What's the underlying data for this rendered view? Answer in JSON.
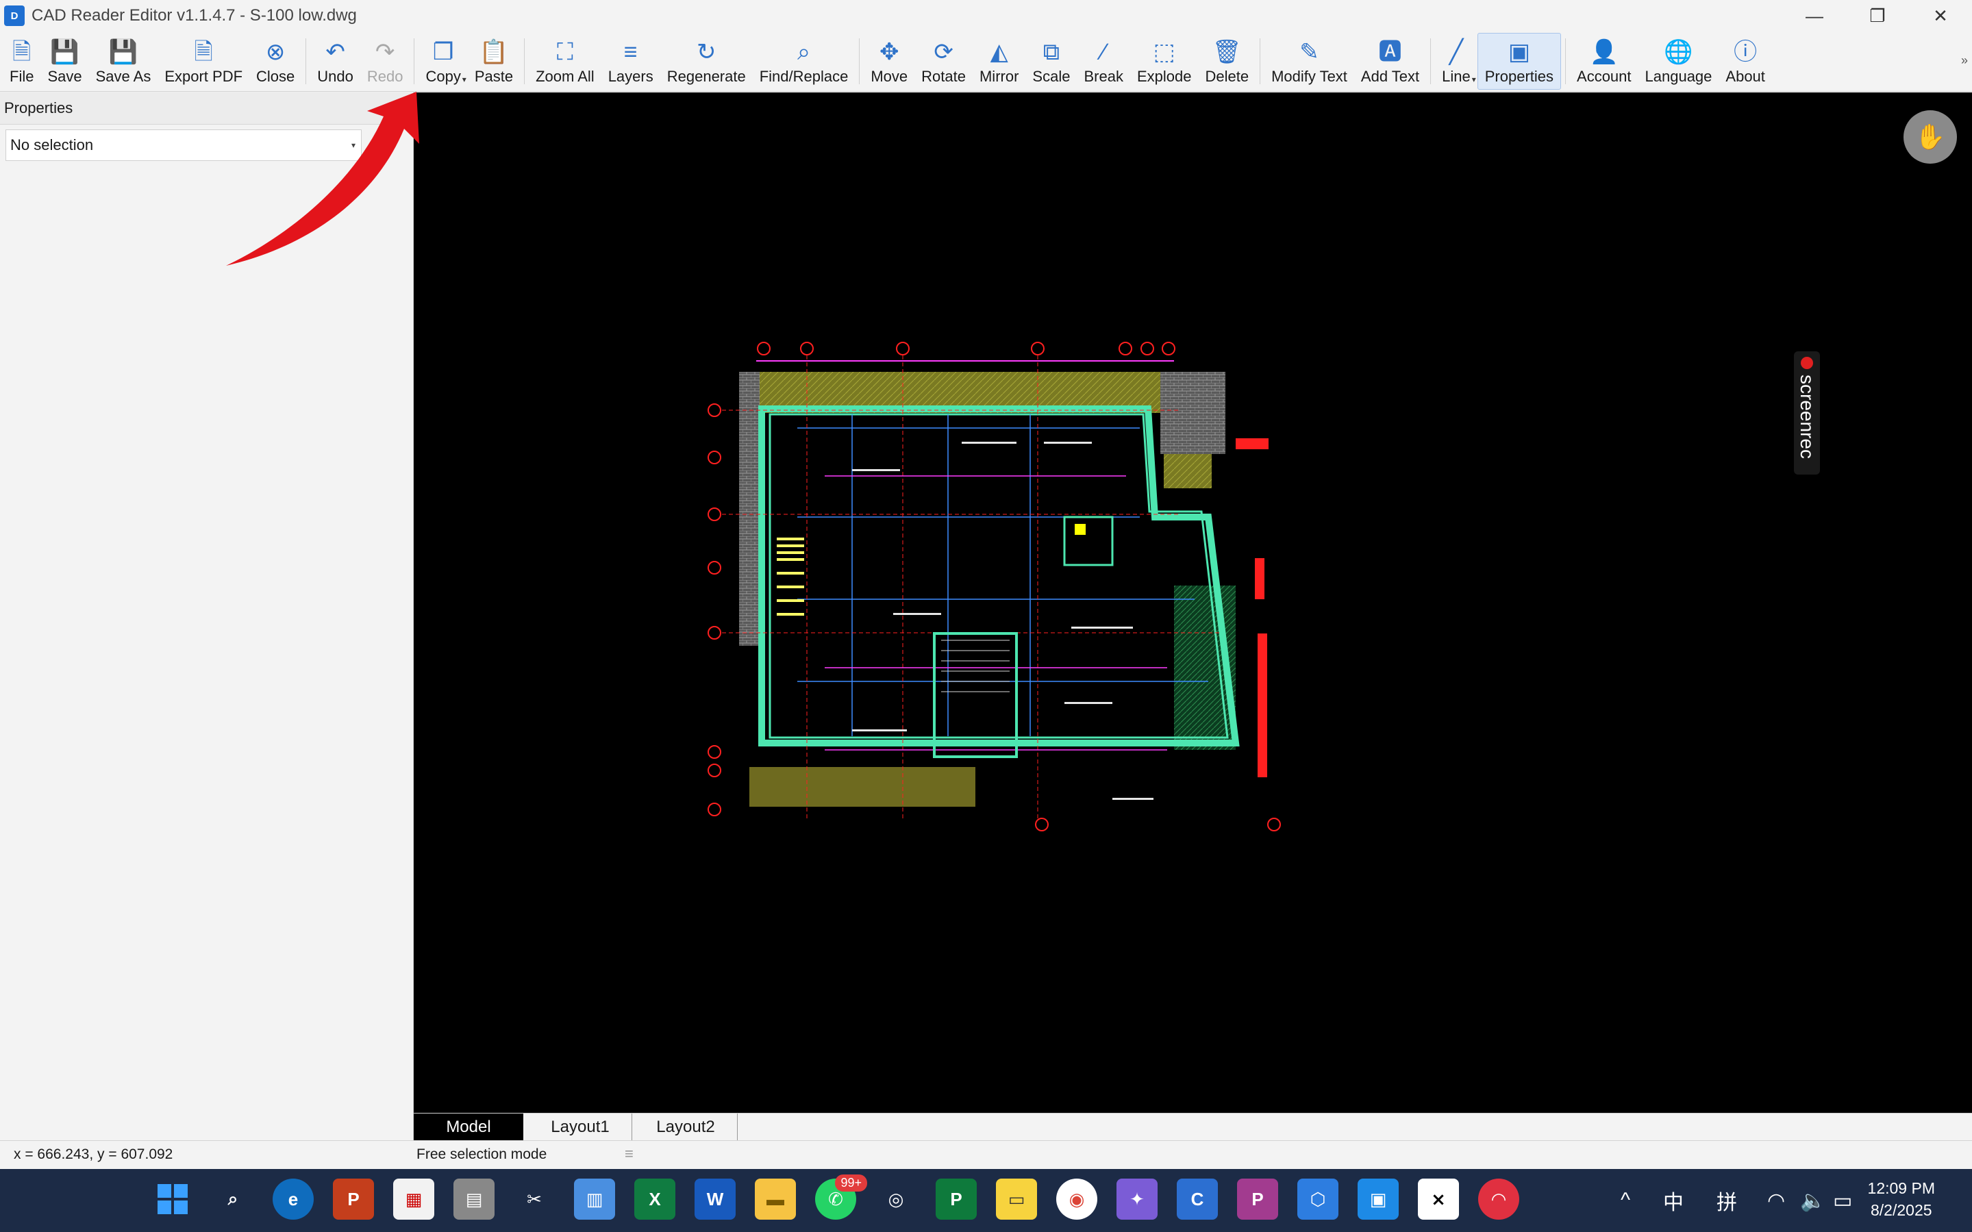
{
  "window": {
    "title": "CAD Reader Editor v1.1.4.7 - S-100 low.dwg",
    "app_icon": "dwg-file-icon",
    "minimize": "—",
    "restore": "❐",
    "close": "✕"
  },
  "toolbar": {
    "items": [
      {
        "id": "file",
        "label": "File",
        "icon": "🗎"
      },
      {
        "id": "save",
        "label": "Save",
        "icon": "💾"
      },
      {
        "id": "save-as",
        "label": "Save As",
        "icon": "💾"
      },
      {
        "id": "export-pdf",
        "label": "Export PDF",
        "icon": "🗎"
      },
      {
        "id": "close",
        "label": "Close",
        "icon": "⊗"
      },
      {
        "id": "undo",
        "label": "Undo",
        "icon": "↶"
      },
      {
        "id": "redo",
        "label": "Redo",
        "icon": "↷"
      },
      {
        "id": "copy",
        "label": "Copy",
        "icon": "❐"
      },
      {
        "id": "paste",
        "label": "Paste",
        "icon": "📋"
      },
      {
        "id": "zoom-all",
        "label": "Zoom All",
        "icon": "⛶"
      },
      {
        "id": "layers",
        "label": "Layers",
        "icon": "≡"
      },
      {
        "id": "regenerate",
        "label": "Regenerate",
        "icon": "↻"
      },
      {
        "id": "find-replace",
        "label": "Find/Replace",
        "icon": "⌕"
      },
      {
        "id": "move",
        "label": "Move",
        "icon": "✥"
      },
      {
        "id": "rotate",
        "label": "Rotate",
        "icon": "⟳"
      },
      {
        "id": "mirror",
        "label": "Mirror",
        "icon": "◭"
      },
      {
        "id": "scale",
        "label": "Scale",
        "icon": "⧉"
      },
      {
        "id": "break",
        "label": "Break",
        "icon": "∕"
      },
      {
        "id": "explode",
        "label": "Explode",
        "icon": "⬚"
      },
      {
        "id": "delete",
        "label": "Delete",
        "icon": "🗑"
      },
      {
        "id": "modify-text",
        "label": "Modify Text",
        "icon": "✎"
      },
      {
        "id": "add-text",
        "label": "Add Text",
        "icon": "🅰"
      },
      {
        "id": "line",
        "label": "Line",
        "icon": "╱"
      },
      {
        "id": "properties",
        "label": "Properties",
        "icon": "▣"
      },
      {
        "id": "account",
        "label": "Account",
        "icon": "👤"
      },
      {
        "id": "language",
        "label": "Language",
        "icon": "🌐"
      },
      {
        "id": "about",
        "label": "About",
        "icon": "ⓘ"
      }
    ],
    "overflow": "»"
  },
  "properties_panel": {
    "header": "Properties",
    "selection_value": "No selection"
  },
  "canvas": {
    "hand_icon": "✋",
    "recorder_label": "screenrec"
  },
  "tabs": [
    {
      "label": "Model",
      "active": true
    },
    {
      "label": "Layout1",
      "active": false
    },
    {
      "label": "Layout2",
      "active": false
    }
  ],
  "status": {
    "coords": "x = 666.243, y = 607.092",
    "mode": "Free selection mode"
  },
  "taskbar": {
    "whatsapp_badge": "99+",
    "tray": {
      "chevron": "^",
      "ime1": "中",
      "ime2": "拼",
      "wifi": "◠",
      "volume": "🔈",
      "battery": "▭"
    },
    "time": "12:09 PM",
    "date": "8/2/2025"
  },
  "colors": {
    "accent": "#2f73c9",
    "annotation_arrow": "#e3141b",
    "canvas_bg": "#000000",
    "cad_wall": "#4de6b0",
    "cad_hatch": "#8c8c2a",
    "cad_red": "#ff2020",
    "cad_magenta": "#ff3cff"
  }
}
